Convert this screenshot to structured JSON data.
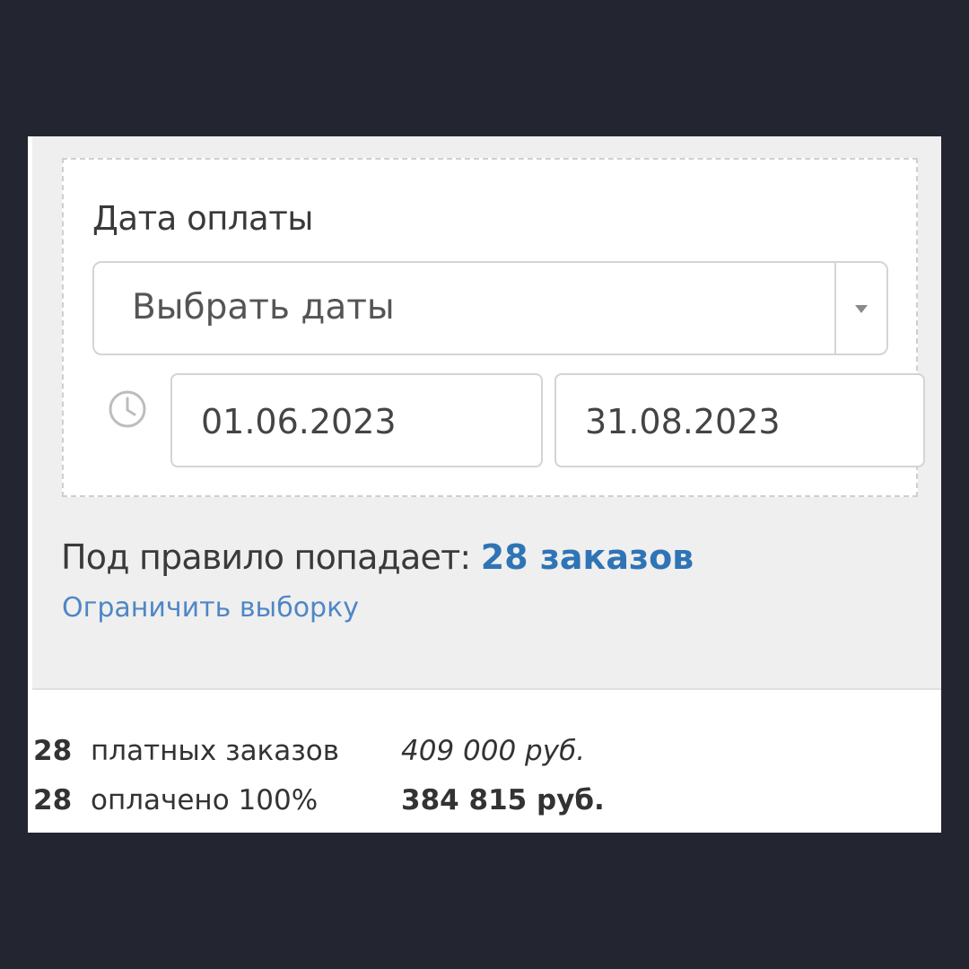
{
  "filter": {
    "label": "Дата оплаты",
    "select_value": "Выбрать даты",
    "date_from": "01.06.2023",
    "date_to": "31.08.2023"
  },
  "summary": {
    "prefix": "Под правило попадает: ",
    "count_text": "28 заказов",
    "limit_link": "Ограничить выборку"
  },
  "stats": {
    "rows": [
      {
        "count": "28",
        "label": "платных заказов",
        "amount": "409 000 руб."
      },
      {
        "count": "28",
        "label": "оплачено 100%",
        "amount": "384 815 руб."
      }
    ]
  },
  "colors": {
    "link": "#2f74b5",
    "background": "#232631"
  },
  "icons": {
    "clock": "clock-icon",
    "dropdown": "chevron-down-icon"
  }
}
